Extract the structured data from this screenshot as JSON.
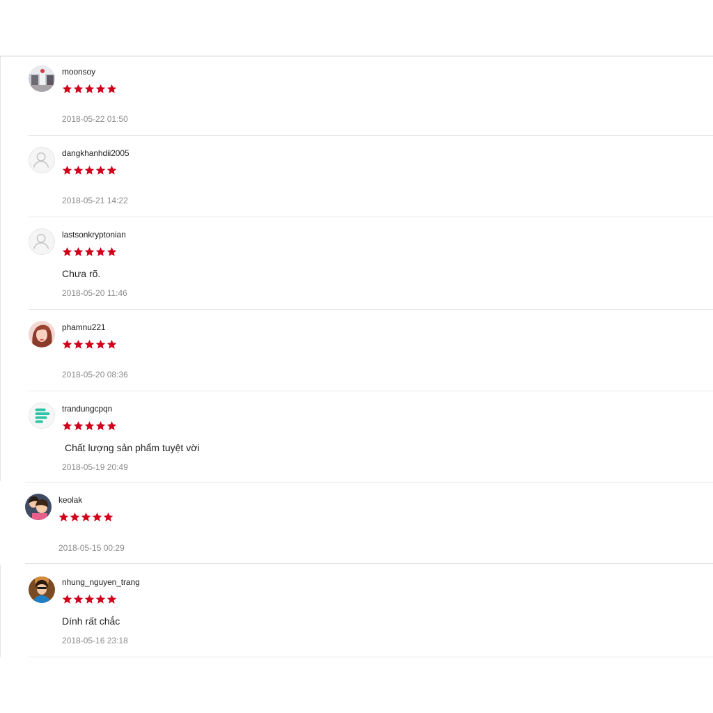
{
  "reviews": [
    {
      "username": "moonsoy",
      "rating": 5,
      "comment": "",
      "time": "2018-05-22 01:50",
      "avatar": "photo-icon"
    },
    {
      "username": "dangkhanhdii2005",
      "rating": 5,
      "comment": "",
      "time": "2018-05-21 14:22",
      "avatar": "default-user-icon"
    },
    {
      "username": "lastsonkryptonian",
      "rating": 5,
      "comment": "Chưa rõ.",
      "time": "2018-05-20 11:46",
      "avatar": "default-user-icon"
    },
    {
      "username": "phamnu221",
      "rating": 5,
      "comment": "",
      "time": "2018-05-20 08:36",
      "avatar": "photo-icon"
    },
    {
      "username": "trandungcpqn",
      "rating": 5,
      "comment": "Chất lượng sản phẩm tuyệt vời",
      "time": "2018-05-19 20:49",
      "avatar": "chat-logo-icon"
    },
    {
      "username": "keolak",
      "rating": 5,
      "comment": "",
      "time": "2018-05-15 00:29",
      "avatar": "photo-icon"
    },
    {
      "username": "nhung_nguyen_trang",
      "rating": 5,
      "comment": "Dính rất chắc",
      "time": "2018-05-16 23:18",
      "avatar": "photo-icon"
    }
  ],
  "colors": {
    "star": "#d0011b",
    "divider": "#e8e8e8",
    "timestamp": "#8a8a8a"
  }
}
